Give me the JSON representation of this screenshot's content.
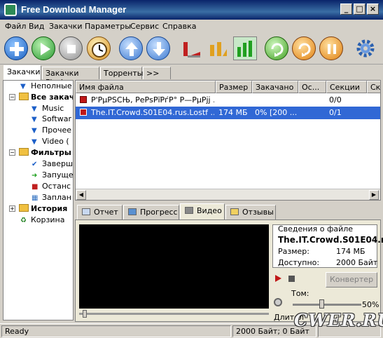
{
  "window": {
    "title": "Free Download Manager"
  },
  "menu": [
    "Файл",
    "Вид",
    "Закачки",
    "Параметры",
    "Сервис",
    "Справка"
  ],
  "tabs": [
    "Закачки",
    "Закачки Flash",
    "Торренты",
    ">>"
  ],
  "tree": [
    {
      "label": "Неполные"
    },
    {
      "label": "Все закач"
    },
    {
      "label": "Music"
    },
    {
      "label": "Softwar"
    },
    {
      "label": "Прочее"
    },
    {
      "label": "Video ("
    },
    {
      "label": "Фильтры"
    },
    {
      "label": "Заверш"
    },
    {
      "label": "Запуще"
    },
    {
      "label": "Останс"
    },
    {
      "label": "Заплан"
    },
    {
      "label": "История"
    },
    {
      "label": "Корзина"
    }
  ],
  "columns": [
    "Имя файла",
    "Размер",
    "Закачано",
    "Ос...",
    "Секции",
    "Ско"
  ],
  "rows": [
    {
      "name": "Р'РµРЅСЊ, РеРѕРїРѓР° Р—РµРјј ...",
      "size": "",
      "done": "",
      "left": "",
      "sections": "0/0",
      "selected": false
    },
    {
      "name": "The.IT.Crowd.S01E04.rus.Lostf ...",
      "size": "174 МБ",
      "done": "0% [200 ...",
      "left": "",
      "sections": "0/1",
      "selected": true
    }
  ],
  "bottom_tabs": [
    "Отчет",
    "Прогресс",
    "Видео",
    "Отзывы"
  ],
  "info": {
    "header": "Сведения о файле",
    "filename": "The.IT.Crowd.S01E04.r",
    "size_label": "Размер:",
    "size_value": "174 МБ",
    "avail_label": "Доступно:",
    "avail_value": "2000 Байт"
  },
  "convert_label": "Конвертер",
  "volume_label": "Том:",
  "volume_percent": "50%",
  "duration_label": "Длител",
  "status": {
    "ready": "Ready",
    "speed": "2000 Байт; 0 Байт"
  },
  "watermark": "CWER.RU",
  "colors": {
    "selection": "#3168d5",
    "title": "#0a246a"
  }
}
